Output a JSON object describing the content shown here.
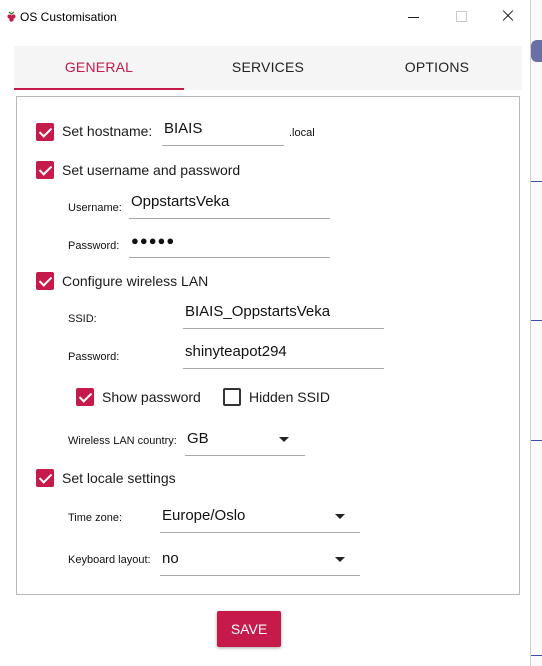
{
  "window": {
    "title": "OS Customisation"
  },
  "tabs": [
    {
      "label": "GENERAL",
      "active": true
    },
    {
      "label": "SERVICES",
      "active": false
    },
    {
      "label": "OPTIONS",
      "active": false
    }
  ],
  "hostname": {
    "label": "Set hostname:",
    "checked": true,
    "value": "BIAIS",
    "suffix": ".local"
  },
  "user": {
    "label": "Set username and password",
    "checked": true,
    "username_label": "Username:",
    "username_value": "OppstartsVeka",
    "password_label": "Password:",
    "password_value": "●●●●●"
  },
  "wlan": {
    "label": "Configure wireless LAN",
    "checked": true,
    "ssid_label": "SSID:",
    "ssid_value": "BIAIS_OppstartsVeka",
    "password_label": "Password:",
    "password_value": "shinyteapot294",
    "show_password_label": "Show password",
    "show_password_checked": true,
    "hidden_ssid_label": "Hidden SSID",
    "hidden_ssid_checked": false,
    "country_label": "Wireless LAN country:",
    "country_value": "GB"
  },
  "locale": {
    "label": "Set locale settings",
    "checked": true,
    "timezone_label": "Time zone:",
    "timezone_value": "Europe/Oslo",
    "keyboard_label": "Keyboard layout:",
    "keyboard_value": "no"
  },
  "save_label": "SAVE",
  "colors": {
    "accent": "#c51a4a",
    "tab_bg": "#f5f5f5",
    "border": "#b8b8b8"
  },
  "icons": [
    "raspberry-icon",
    "minimize-icon",
    "maximize-icon",
    "close-icon",
    "dropdown-caret-icon",
    "checkbox-checked-icon"
  ]
}
